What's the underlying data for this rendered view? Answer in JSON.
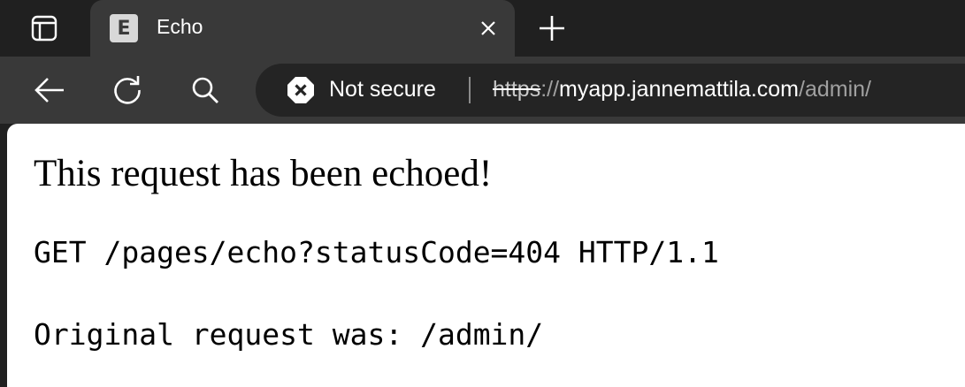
{
  "browser": {
    "tab": {
      "favicon_letter": "E",
      "title": "Echo"
    },
    "address_bar": {
      "security_label": "Not secure",
      "url_scheme": "https",
      "url_separator": "://",
      "url_host": "myapp.jannemattila.com",
      "url_path": "/admin/"
    },
    "colors": {
      "tabbar_bg": "#202020",
      "toolbar_bg": "#393939",
      "omnibox_bg": "#242424",
      "page_bg": "#ffffff"
    },
    "icons": [
      "tab-actions-icon",
      "close-icon",
      "new-tab-icon",
      "back-icon",
      "refresh-icon",
      "search-icon",
      "not-secure-icon"
    ]
  },
  "page": {
    "heading": "This request has been echoed!",
    "request_line": "GET /pages/echo?statusCode=404 HTTP/1.1",
    "original_request": "Original request was: /admin/"
  }
}
